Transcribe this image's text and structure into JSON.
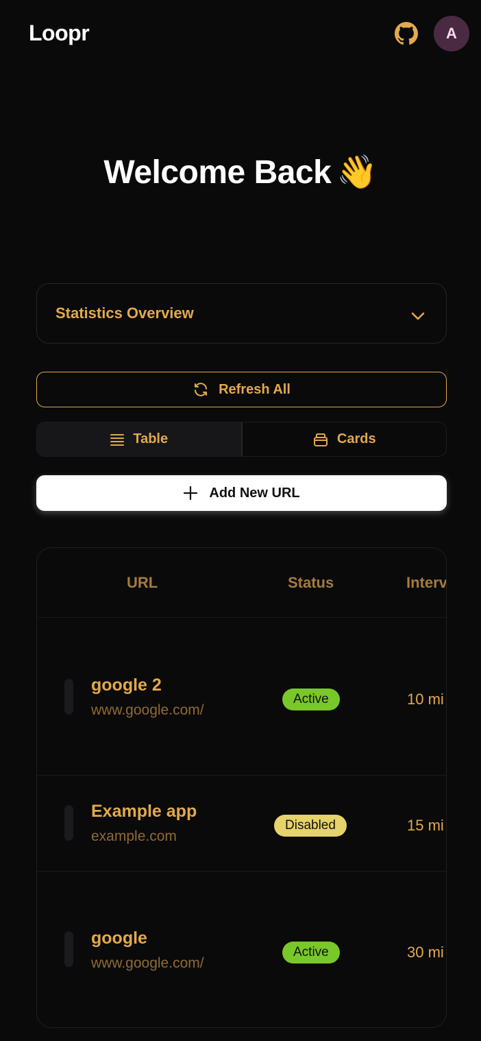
{
  "app": {
    "name": "Loopr",
    "avatar_initial": "A"
  },
  "icons": {
    "github": "github-icon",
    "chevron": "chevron-down-icon",
    "refresh": "refresh-icon",
    "table": "table-list-icon",
    "cards": "cards-icon",
    "plus": "plus-icon"
  },
  "colors": {
    "accent": "#e3a94a",
    "active_badge": "#78c829",
    "disabled_badge": "#e6d36a",
    "background": "#0a0a0b",
    "avatar_bg": "#4a2a42"
  },
  "hero": {
    "title": "Welcome Back",
    "emoji": "👋"
  },
  "stats": {
    "label": "Statistics Overview",
    "expanded": false
  },
  "actions": {
    "refresh_all": "Refresh All",
    "add_new_url": "Add New URL"
  },
  "view_toggle": {
    "table": "Table",
    "cards": "Cards",
    "selected": "table"
  },
  "table": {
    "headers": {
      "url": "URL",
      "status": "Status",
      "interval": "Interv"
    },
    "rows": [
      {
        "name": "google 2",
        "host": "www.google.com/",
        "status": "Active",
        "interval": "10 mi"
      },
      {
        "name": "Example app",
        "host": "example.com",
        "status": "Disabled",
        "interval": "15 mi"
      },
      {
        "name": "google",
        "host": "www.google.com/",
        "status": "Active",
        "interval": "30 mi"
      }
    ]
  }
}
